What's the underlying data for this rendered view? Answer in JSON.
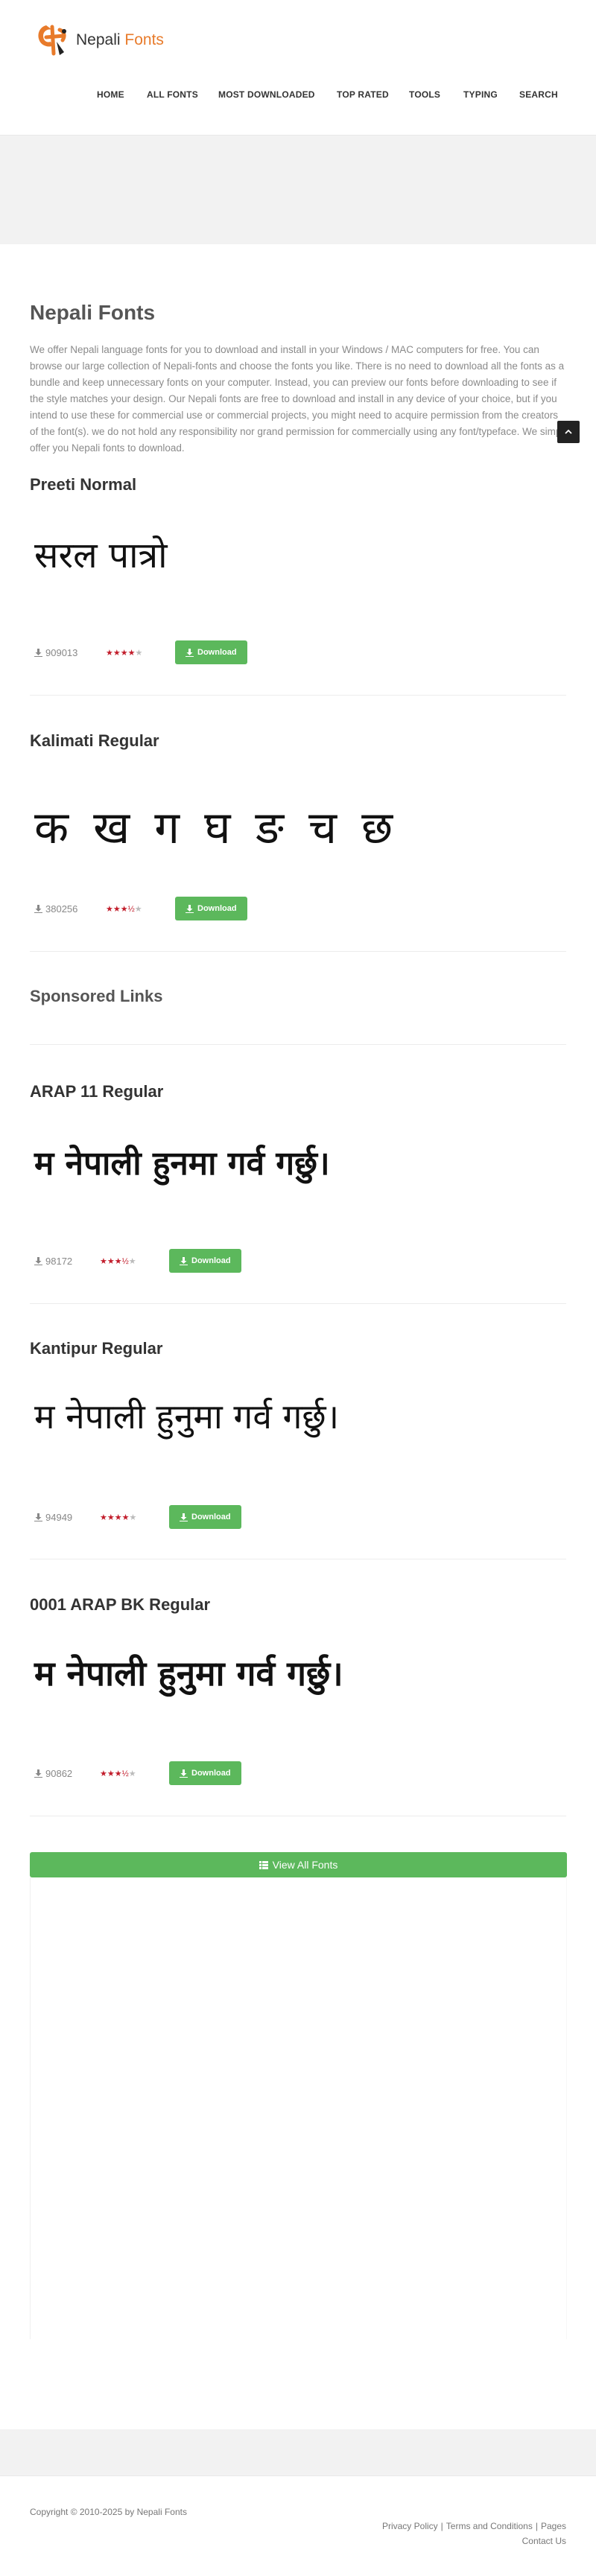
{
  "brand": {
    "name_main": "Nepali",
    "name_accent": "Fonts",
    "accent_color": "#e87b2b"
  },
  "nav": [
    "HOME",
    "ALL FONTS",
    "MOST DOWNLOADED",
    "TOP RATED",
    "TOOLS",
    "TYPING",
    "SEARCH"
  ],
  "page": {
    "title": "Nepali Fonts",
    "intro": "We offer Nepali language fonts for you to download and install in your Windows / MAC computers for free. You can browse our large collection of Nepali-fonts and choose the fonts you like. There is no need to download all the fonts as a bundle and keep unnecessary fonts on your computer. Instead, you can preview our fonts before downloading to see if the style matches your design. Our Nepali fonts are free to download and install in any device of your choice, but if you intend to use these for commercial use or commercial projects, you might need to acquire permission from the creators of the font(s). we do not hold any responsibility nor grand permission for commercially using any font/typeface. We simply offer you Nepali fonts to download."
  },
  "download_label": "Download",
  "sponsored_label": "Sponsored Links",
  "fonts": [
    {
      "name": "Preeti Normal",
      "preview": "सरल पात्रो",
      "downloads": "909013",
      "rating": 4
    },
    {
      "name": "Kalimati Regular",
      "preview": "क ख ग घ ङ च छ",
      "downloads": "380256",
      "rating": 3.5
    },
    {
      "name": "ARAP 11 Regular",
      "preview": "म नेपाली हुनमा गर्व गर्छु।",
      "downloads": "98172",
      "rating": 3.5
    },
    {
      "name": "Kantipur Regular",
      "preview": "म नेपाली हुनुमा गर्व गर्छु।",
      "downloads": "94949",
      "rating": 4
    },
    {
      "name": "0001 ARAP BK Regular",
      "preview": "म नेपाली हुनुमा गर्व गर्छु।",
      "downloads": "90862",
      "rating": 3.5
    }
  ],
  "view_all_label": "View All Fonts",
  "footer": {
    "copyright": "Copyright © 2010-2025 by Nepali Fonts",
    "links": [
      "Privacy Policy",
      "Terms and Conditions",
      "Pages"
    ],
    "contact": "Contact Us"
  },
  "colors": {
    "download_button": "#5cb85c",
    "stars": "#c21d2b"
  }
}
